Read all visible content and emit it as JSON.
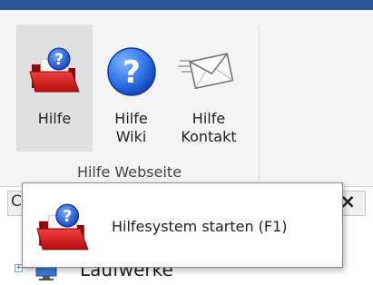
{
  "ribbon": {
    "buttons": [
      {
        "id": "hilfe",
        "label": "Hilfe",
        "icon": "help-folder-icon",
        "selected": true
      },
      {
        "id": "wiki",
        "label": "Hilfe\nWiki",
        "icon": "help-question-icon",
        "selected": false
      },
      {
        "id": "kontakt",
        "label": "Hilfe\nKontakt",
        "icon": "mail-envelope-icon",
        "selected": false
      }
    ],
    "group_label": "Hilfe Webseite"
  },
  "panel": {
    "header_letter": "C",
    "close_symbol": "×",
    "tree_expander": "+",
    "tree_item_label": "Laufwerke",
    "tree_item_icon": "computer-icon"
  },
  "tooltip": {
    "text": "Hilfesystem starten (F1)",
    "icon": "help-folder-icon"
  },
  "colors": {
    "topbar": "#2b5797",
    "folder_red": "#d91f1f",
    "help_blue": "#1c63d6"
  }
}
